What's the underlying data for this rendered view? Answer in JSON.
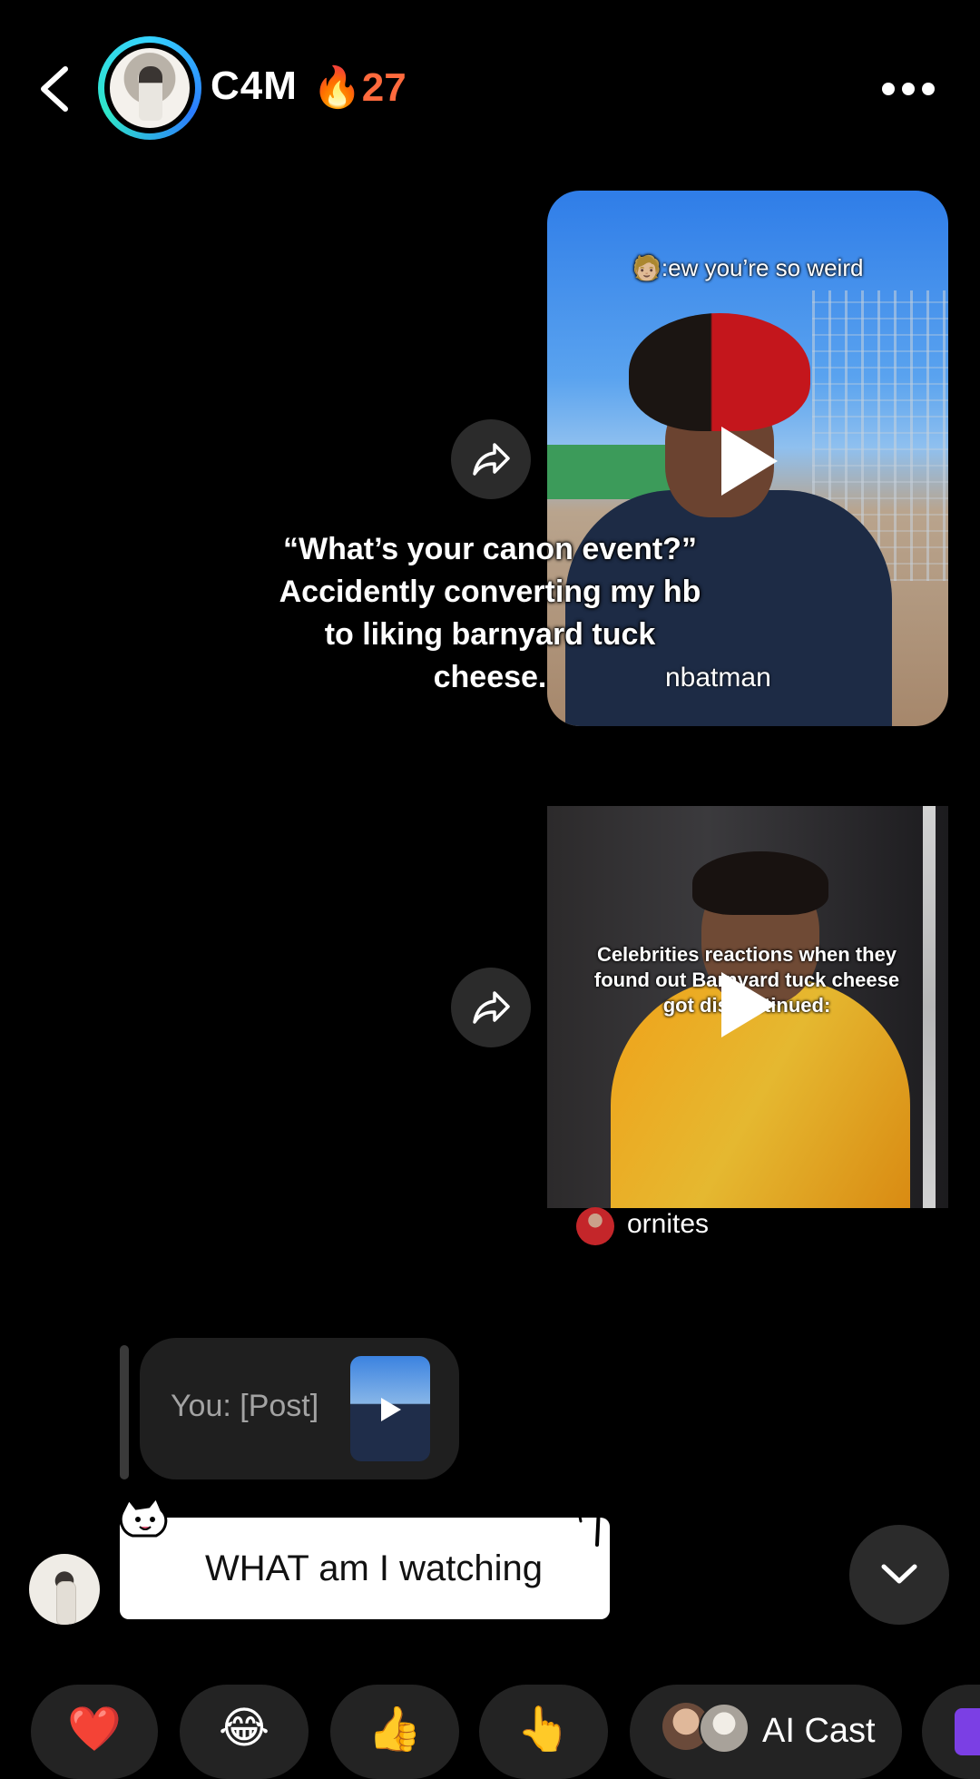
{
  "header": {
    "username": "C4M",
    "streak_count": "🔥27"
  },
  "shared_posts": [
    {
      "caption": "🧑🏼:ew you’re so weird",
      "author": "nbatman"
    },
    {
      "caption": "Celebrities reactions when they found out Barnyard tuck cheese got discontinued:",
      "author": "ornites"
    }
  ],
  "overlay_caption": "“What’s your canon event?” Accidently converting my hb to liking barnyard tuck cheese.",
  "reply_preview": {
    "text": "You: [Post]"
  },
  "message": {
    "text": "WHAT am I watching"
  },
  "reactions": [
    {
      "emoji": "❤️"
    },
    {
      "emoji": "😂"
    },
    {
      "emoji": "👍"
    },
    {
      "emoji": "👆"
    },
    {
      "label": "AI Cast"
    }
  ],
  "colors": {
    "background": "#000000",
    "streak": "#ff6a3d",
    "avatar_ring": "#35d3ff",
    "bubble_dark": "#1f1f1f"
  },
  "icons": {
    "back": "chevron-left-icon",
    "more": "more-horizontal-icon",
    "share": "share-arrow-icon",
    "play": "play-icon",
    "scroll_down": "chevron-down-icon"
  }
}
